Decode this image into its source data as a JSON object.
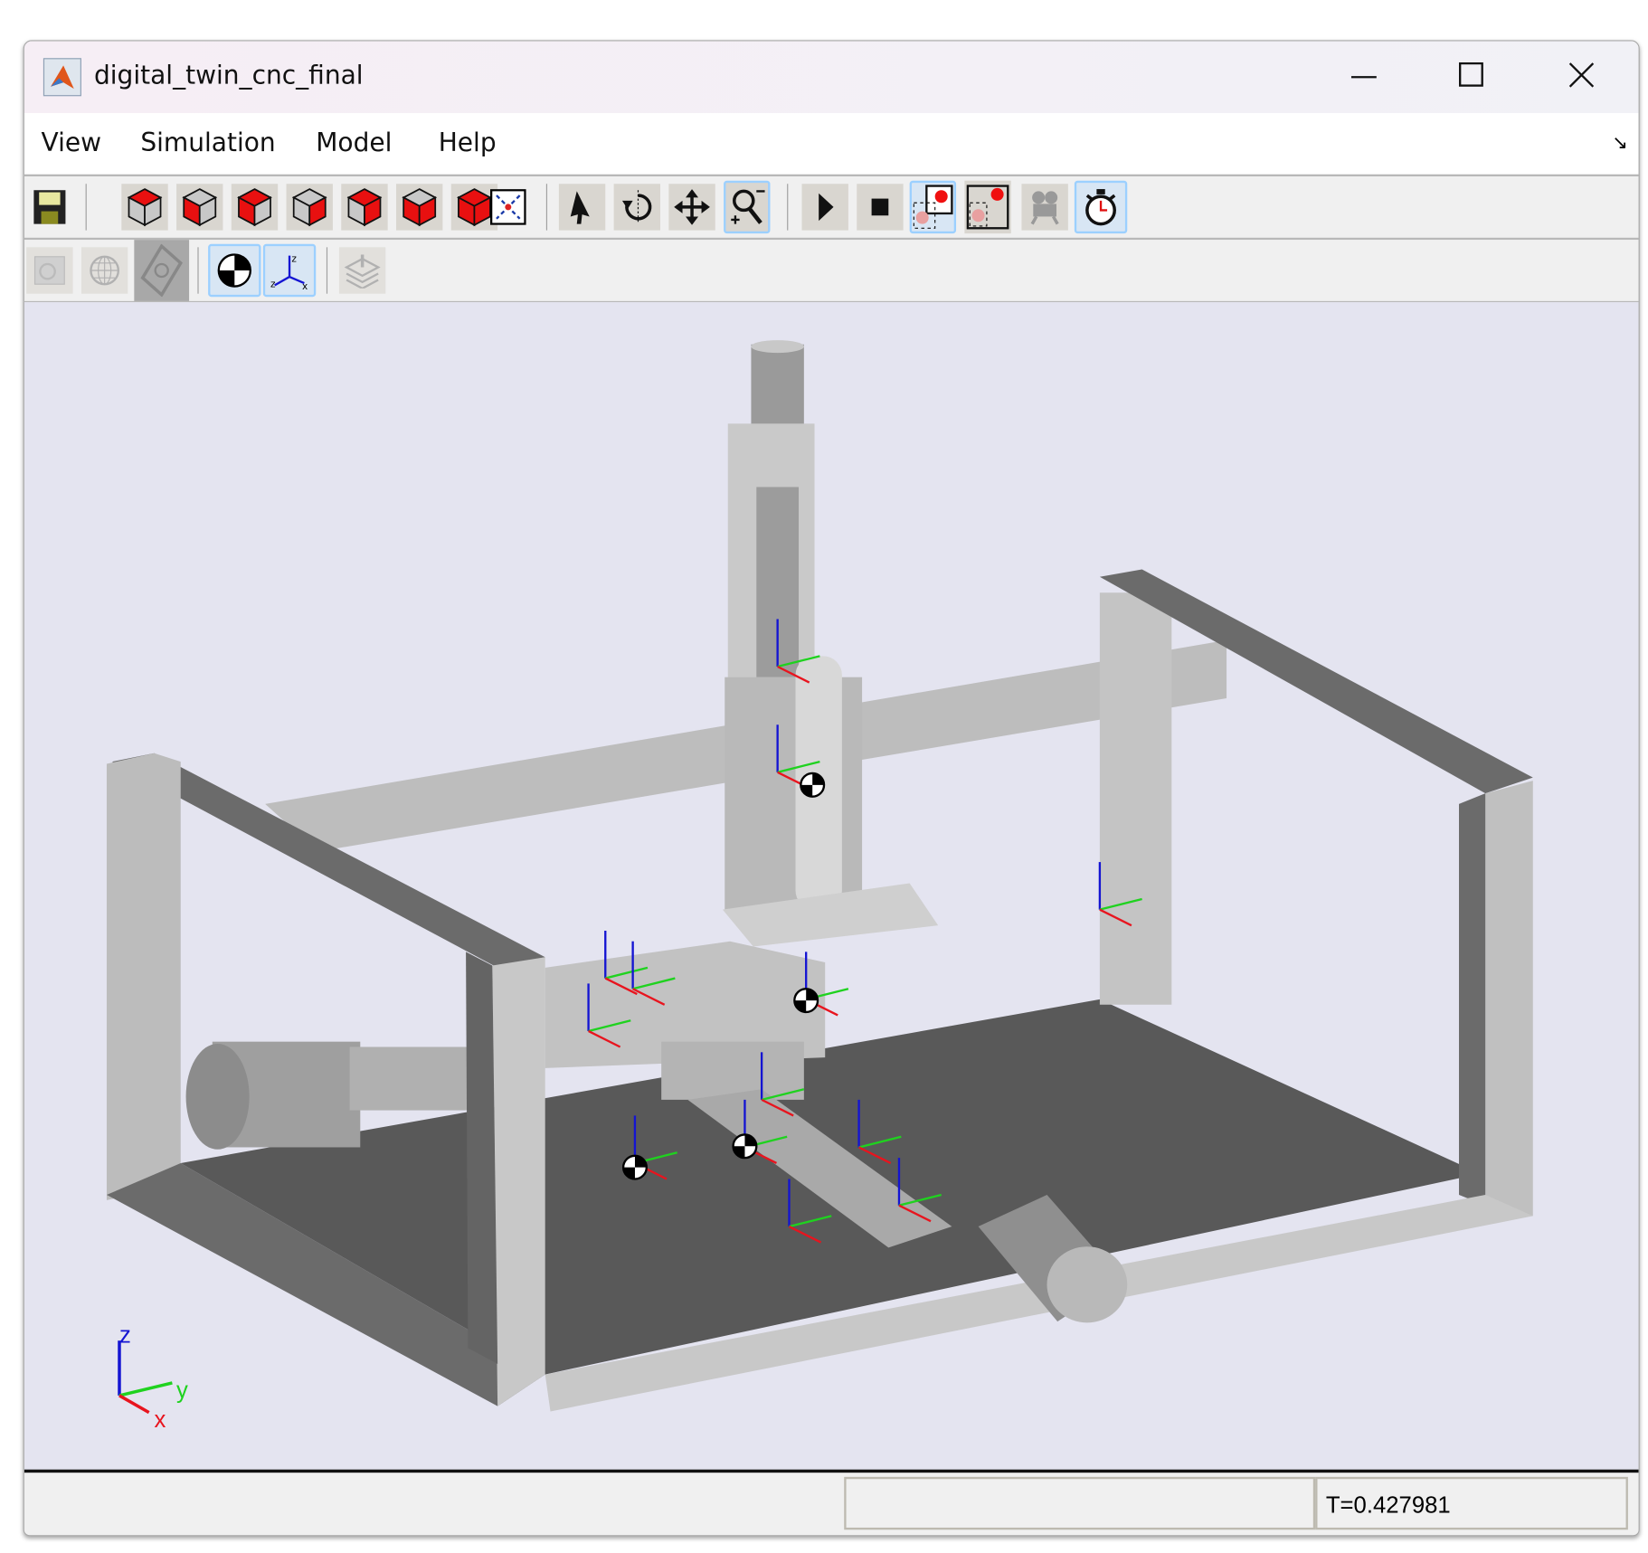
{
  "window": {
    "title": "digital_twin_cnc_final",
    "minimize_icon": "minimize-icon",
    "maximize_icon": "maximize-icon",
    "close_icon": "close-icon"
  },
  "menu": [
    {
      "label": "View"
    },
    {
      "label": "Simulation"
    },
    {
      "label": "Model"
    },
    {
      "label": "Help"
    }
  ],
  "toolbar1": [
    "save-icon",
    "view-front-icon",
    "view-left-icon",
    "view-top-icon",
    "view-bottom-icon",
    "view-right-icon",
    "view-back-icon",
    "view-isometric-icon",
    "fit-to-view-icon",
    "select-icon",
    "rotate-icon",
    "pan-icon",
    "zoom-icon",
    "play-icon",
    "stop-icon",
    "camera-record-icon",
    "camera-manager-icon",
    "video-camera-icon",
    "timer-icon"
  ],
  "toolbar2": [
    "texture-icon",
    "wireframe-icon",
    "convex-hull-icon",
    "center-of-mass-icon",
    "frames-icon",
    "layers-icon"
  ],
  "viewport": {
    "axis_labels": {
      "z": "z",
      "y": "y",
      "x": "x"
    },
    "colors": {
      "x": "#e8141e",
      "y": "#1fd21f",
      "z": "#1414d2"
    }
  },
  "status": {
    "message": "",
    "time": "T=0.427981"
  }
}
